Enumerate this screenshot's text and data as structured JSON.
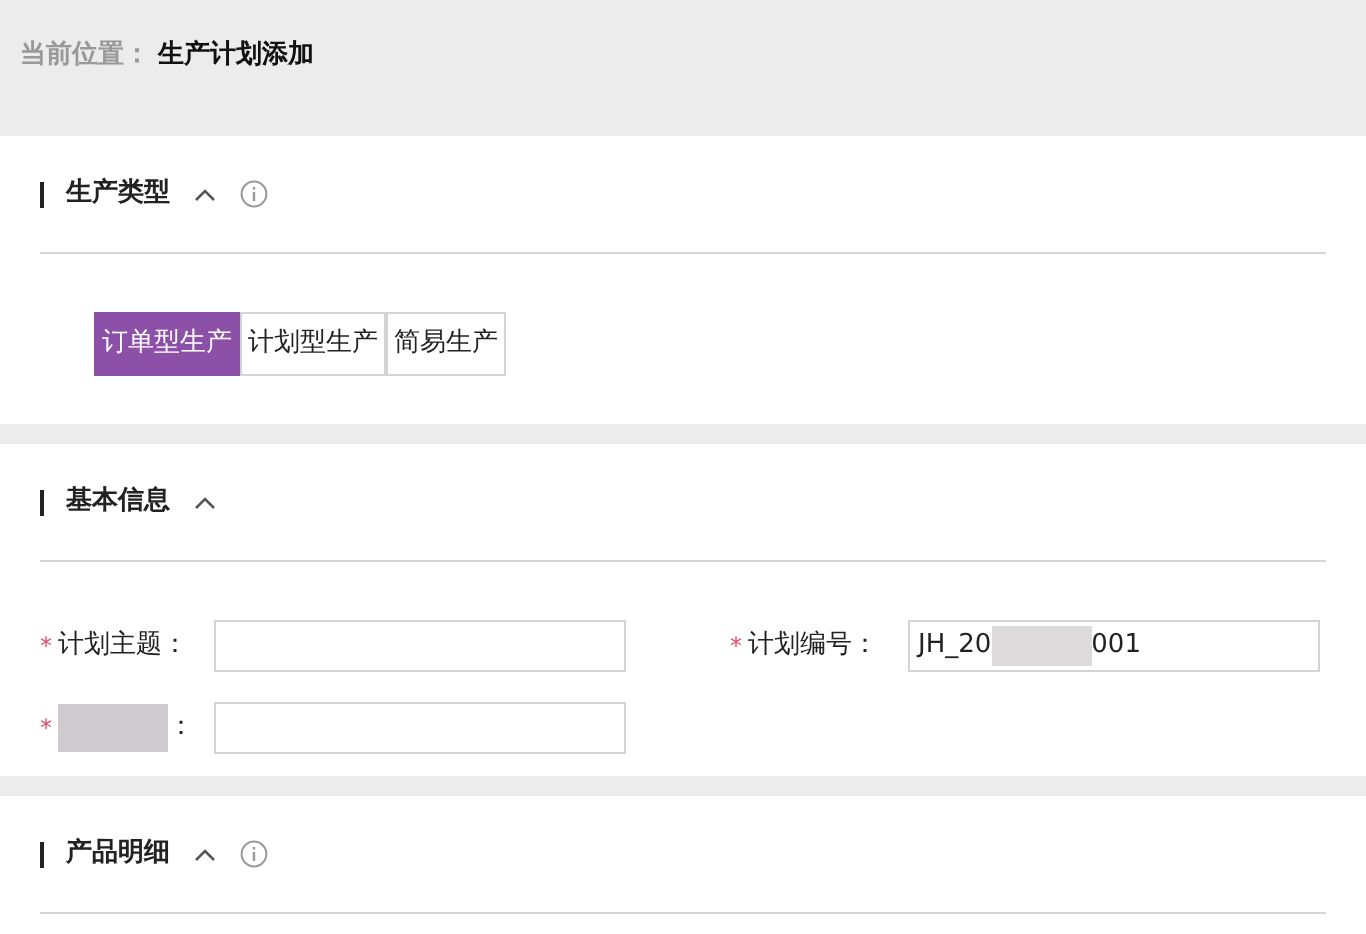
{
  "breadcrumb": {
    "label": "当前位置：",
    "current": "生产计划添加"
  },
  "sections": [
    {
      "title": "生产类型",
      "expanded": true,
      "info": true,
      "kind": "types",
      "options": [
        {
          "label": "订单型生产",
          "selected": true
        },
        {
          "label": "计划型生产",
          "selected": false
        },
        {
          "label": "简易生产",
          "selected": false
        }
      ]
    },
    {
      "title": "基本信息",
      "expanded": true,
      "info": false,
      "kind": "form",
      "fields": [
        {
          "mark": "*",
          "label_parts": [
            {
              "kind": "text",
              "text": "计划主题："
            }
          ]
        },
        {
          "mark": "*",
          "label_parts": [
            {
              "kind": "text",
              "text": "计划编号："
            }
          ],
          "value_parts": [
            {
              "kind": "text",
              "text": "JH_20"
            },
            {
              "kind": "redacted"
            },
            {
              "kind": "text",
              "text": "001"
            }
          ]
        },
        {
          "mark": "*",
          "label_parts": [
            {
              "kind": "redacted"
            },
            {
              "kind": "text",
              "text": "："
            }
          ]
        }
      ]
    },
    {
      "title": "产品明细",
      "expanded": true,
      "info": true,
      "kind": "empty"
    }
  ]
}
